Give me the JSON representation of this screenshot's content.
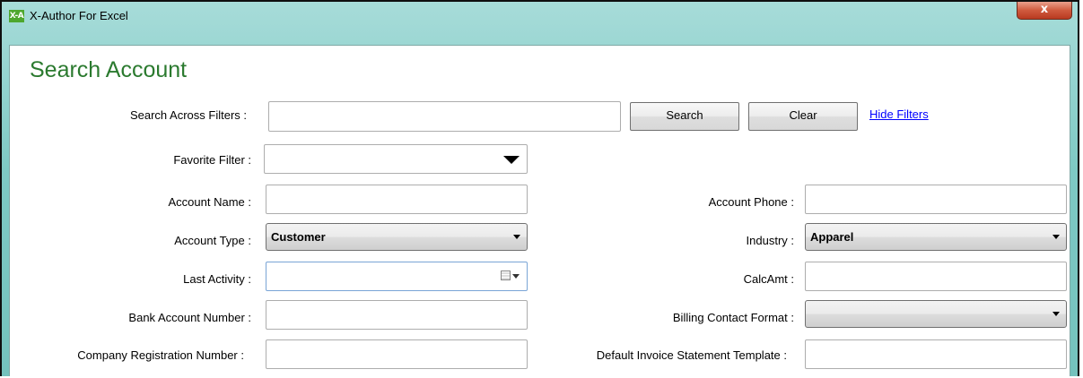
{
  "window": {
    "title": "X-Author For Excel",
    "icon": "X-A",
    "close_glyph": "x"
  },
  "page": {
    "heading": "Search Account"
  },
  "search": {
    "label": "Search Across Filters :",
    "value": "",
    "search_button": "Search",
    "clear_button": "Clear",
    "hide_filters_link": "Hide Filters"
  },
  "favorite": {
    "label": "Favorite Filter :",
    "value": ""
  },
  "fields": {
    "account_name": {
      "label": "Account Name :",
      "value": ""
    },
    "account_phone": {
      "label": "Account Phone :",
      "value": ""
    },
    "account_type": {
      "label": "Account Type :",
      "value": "Customer"
    },
    "industry": {
      "label": "Industry :",
      "value": "Apparel"
    },
    "last_activity": {
      "label": "Last Activity :",
      "value": ""
    },
    "calcamt": {
      "label": "CalcAmt :",
      "value": ""
    },
    "bank_account_number": {
      "label": "Bank Account Number :",
      "value": ""
    },
    "billing_contact_format": {
      "label": "Billing Contact Format :",
      "value": ""
    },
    "company_registration_number": {
      "label": "Company Registration Number :",
      "value": ""
    },
    "default_invoice_statement_template": {
      "label": "Default Invoice Statement Template :",
      "value": ""
    }
  },
  "colors": {
    "accent_green": "#2b7a2f",
    "title_bar": "#7ec9c4",
    "link": "#0000ff",
    "close": "#cf5a3e"
  }
}
